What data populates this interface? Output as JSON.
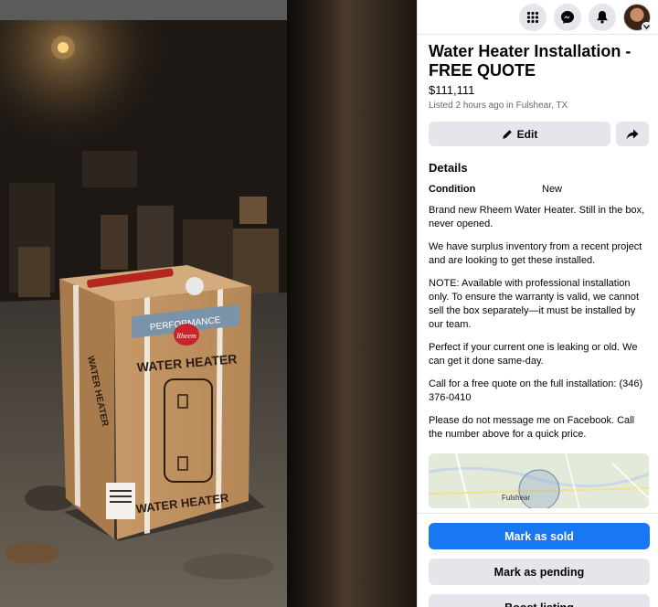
{
  "listing": {
    "title": "Water Heater Installation - FREE QUOTE",
    "price": "$111,111",
    "meta": "Listed 2 hours ago in Fulshear, TX"
  },
  "actions": {
    "edit_label": "Edit"
  },
  "details": {
    "heading": "Details",
    "condition_label": "Condition",
    "condition_value": "New",
    "description": [
      "Brand new Rheem Water Heater. Still in the box, never opened.",
      "We have surplus inventory from a recent project and are looking to get these installed.",
      "NOTE: Available with professional installation only. To ensure the warranty is valid, we cannot sell the box separately—it must be installed by our team.",
      "Perfect if your current one is leaking or old. We can get it done same-day.",
      "Call for a free quote on the full installation: (346) 376-0410",
      "Please do not message me on Facebook. Call the number above for a quick price."
    ]
  },
  "map": {
    "label": "Fulshear"
  },
  "product_box": {
    "brand": "Rheem",
    "band": "PERFORMANCE",
    "front_label": "WATER HEATER",
    "bottom_label": "WATER HEATER",
    "side_label": "WATER HEATER"
  },
  "bottom_actions": {
    "mark_sold": "Mark as sold",
    "mark_pending": "Mark as pending",
    "boost": "Boost listing"
  },
  "icons": {
    "menu": "grid-menu-icon",
    "messenger": "messenger-icon",
    "notifications": "bell-icon",
    "edit": "pencil-icon",
    "share": "share-arrow-icon"
  },
  "colors": {
    "primary": "#1877f2",
    "secondary_bg": "#e4e6eb"
  }
}
